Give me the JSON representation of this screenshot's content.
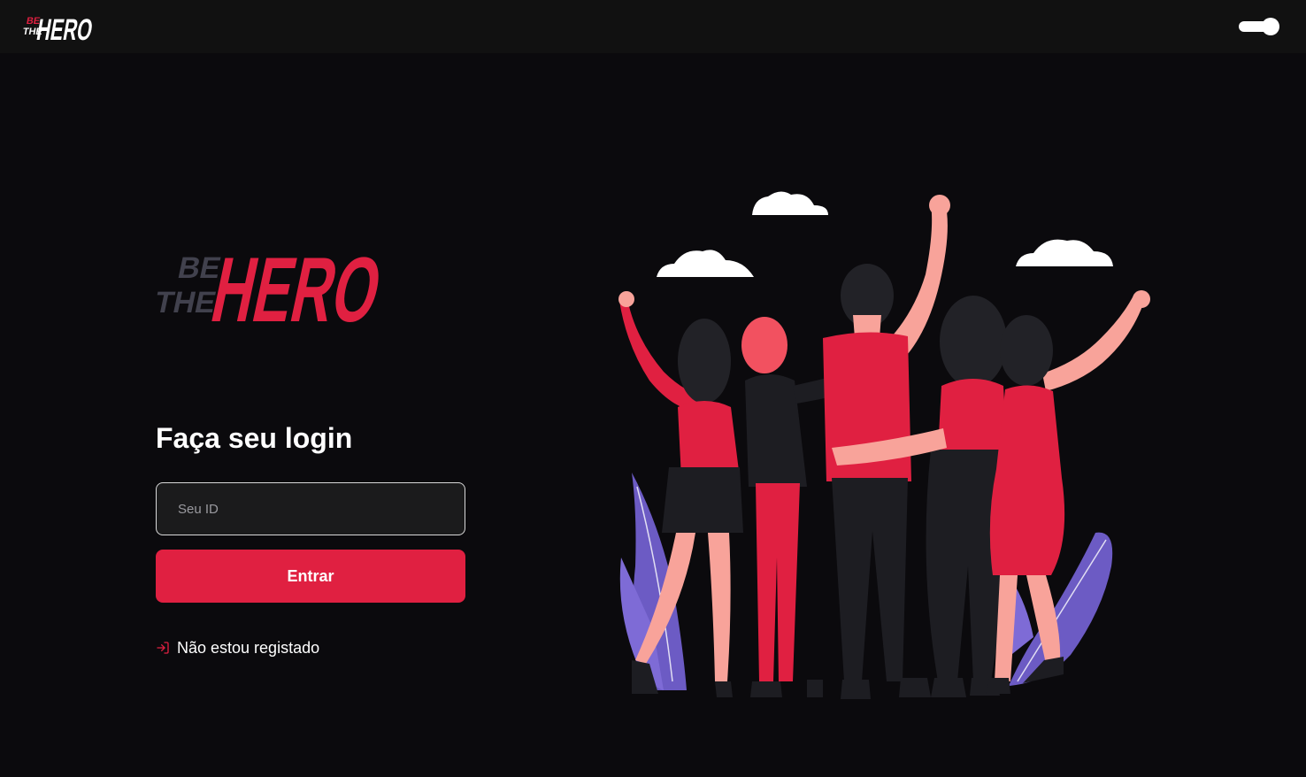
{
  "header": {
    "logo": {
      "line1": "BE",
      "line2": "THE",
      "word": "HERO"
    },
    "theme_toggle": {
      "state": "on"
    }
  },
  "login": {
    "logo": {
      "line1": "BE",
      "line2": "THE",
      "word": "HERO"
    },
    "title": "Faça seu login",
    "id_input": {
      "placeholder": "Seu ID",
      "value": ""
    },
    "submit_label": "Entrar",
    "register_link": {
      "label": "Não estou registado",
      "icon": "log-in-icon"
    }
  },
  "illustration": {
    "name": "group-of-friends-waving"
  },
  "colors": {
    "brand": "#e02041",
    "background": "#0b0a0d",
    "header": "#111111",
    "input_bg": "#1b1b1c",
    "logo_muted": "#41414d",
    "plant": "#6c5bc4"
  }
}
